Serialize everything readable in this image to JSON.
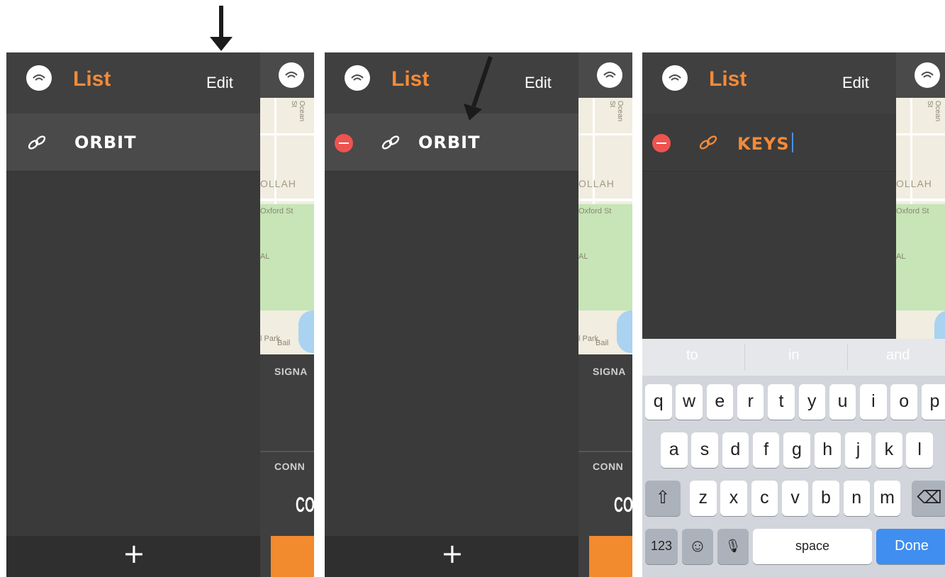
{
  "panels": [
    {
      "header": {
        "title": "List",
        "edit": "Edit"
      },
      "row": {
        "label": "ORBIT"
      },
      "map": {
        "street_vertical": "Ocean St",
        "district": "OLLAH",
        "street_oxford": "Oxford St",
        "area_label": "AL",
        "park_label": "l Park",
        "park_label2": "Bail"
      },
      "lower": {
        "signal": "SIGNA",
        "conn": "CONN",
        "big": "CO"
      }
    },
    {
      "header": {
        "title": "List",
        "edit": "Edit"
      },
      "row": {
        "label": "ORBIT"
      },
      "map": {
        "street_vertical": "Ocean St",
        "district": "OLLAH",
        "street_oxford": "Oxford St",
        "area_label": "AL",
        "park_label": "l Park",
        "park_label2": "Bail"
      },
      "lower": {
        "signal": "SIGNA",
        "conn": "CONN",
        "big": "CO"
      }
    },
    {
      "header": {
        "title": "List",
        "edit": "Edit"
      },
      "row": {
        "label": "KEYS"
      },
      "map": {
        "street_vertical": "Ocean St",
        "district": "OLLAH",
        "street_oxford": "Oxford St",
        "area_label": "AL"
      }
    }
  ],
  "footer": {
    "plus": "+"
  },
  "keyboard": {
    "suggestions": [
      "to",
      "in",
      "and"
    ],
    "row1": [
      "q",
      "w",
      "e",
      "r",
      "t",
      "y",
      "u",
      "i",
      "o",
      "p"
    ],
    "row2": [
      "a",
      "s",
      "d",
      "f",
      "g",
      "h",
      "j",
      "k",
      "l"
    ],
    "row3": [
      "z",
      "x",
      "c",
      "v",
      "b",
      "n",
      "m"
    ],
    "num_key": "123",
    "space_key": "space",
    "done_key": "Done"
  },
  "colors": {
    "accent": "#f38a38",
    "delete": "#ef5350",
    "done": "#3f8ef0"
  }
}
